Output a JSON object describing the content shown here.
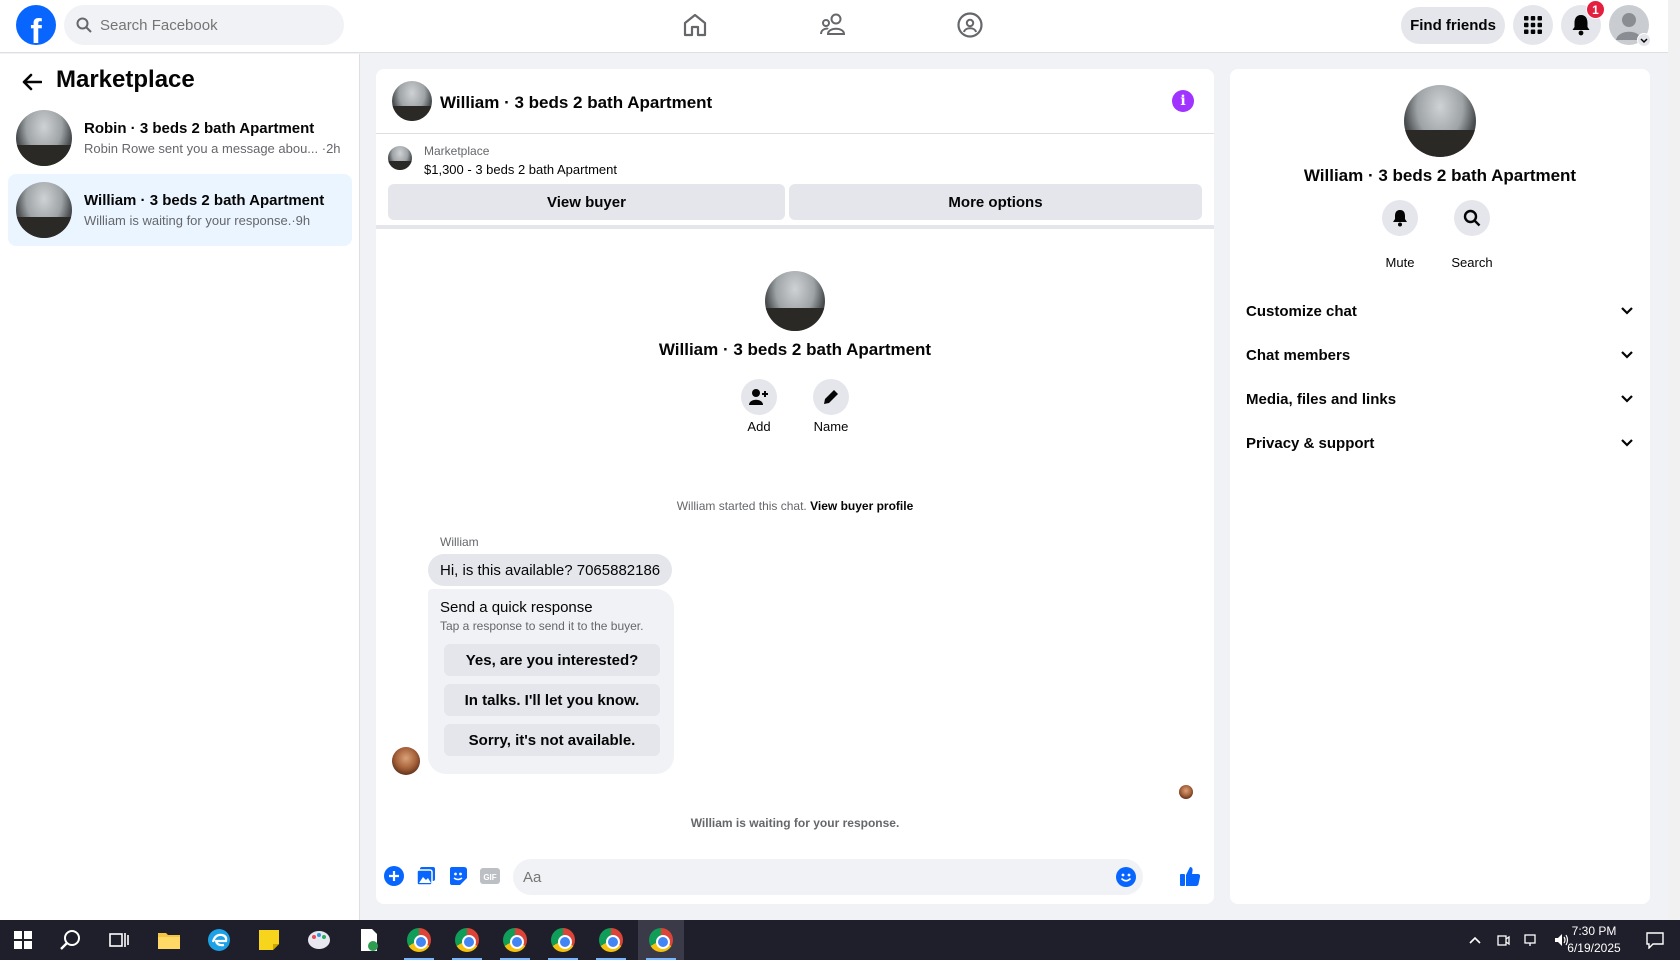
{
  "topbar": {
    "search_placeholder": "Search Facebook",
    "find_friends_label": "Find friends",
    "notification_count": "1"
  },
  "sidebar": {
    "title": "Marketplace",
    "conversations": [
      {
        "title": "Robin · 3 beds 2 bath Apartment",
        "subtitle": "Robin Rowe sent you a message abou... ·2h",
        "active": false
      },
      {
        "title": "William · 3 beds 2 bath Apartment",
        "subtitle": "William is waiting for your response.·9h",
        "active": true
      }
    ]
  },
  "chat": {
    "header_title": "William · 3 beds 2 bath Apartment",
    "info_glyph": "i",
    "listing": {
      "label": "Marketplace",
      "price_title": "$1,300 - 3 beds 2 bath Apartment",
      "view_buyer_label": "View buyer",
      "more_options_label": "More options"
    },
    "profile": {
      "name": "William · 3 beds 2 bath Apartment",
      "add_label": "Add",
      "name_label": "Name"
    },
    "started_text": "William started this chat.",
    "view_buyer_profile_link": "View buyer profile",
    "sender_name": "William",
    "message": "Hi, is this available? 7065882186",
    "quick_response": {
      "title": "Send a quick response",
      "subtitle": "Tap a response to send it to the buyer.",
      "options": [
        "Yes, are you interested?",
        "In talks. I'll let you know.",
        "Sorry, it's not available."
      ]
    },
    "waiting_text": "William is waiting for your response.",
    "composer_placeholder": "Aa"
  },
  "right_panel": {
    "name": "William · 3 beds 2 bath Apartment",
    "mute_label": "Mute",
    "search_label": "Search",
    "sections": [
      "Customize chat",
      "Chat members",
      "Media, files and links",
      "Privacy & support"
    ]
  },
  "taskbar": {
    "time": "7:30 PM",
    "date": "6/19/2025"
  },
  "colors": {
    "facebook_blue": "#0866ff",
    "active_conversation": "#ebf5ff",
    "info_purple": "#a033ff",
    "badge_red": "#e41e3f"
  }
}
